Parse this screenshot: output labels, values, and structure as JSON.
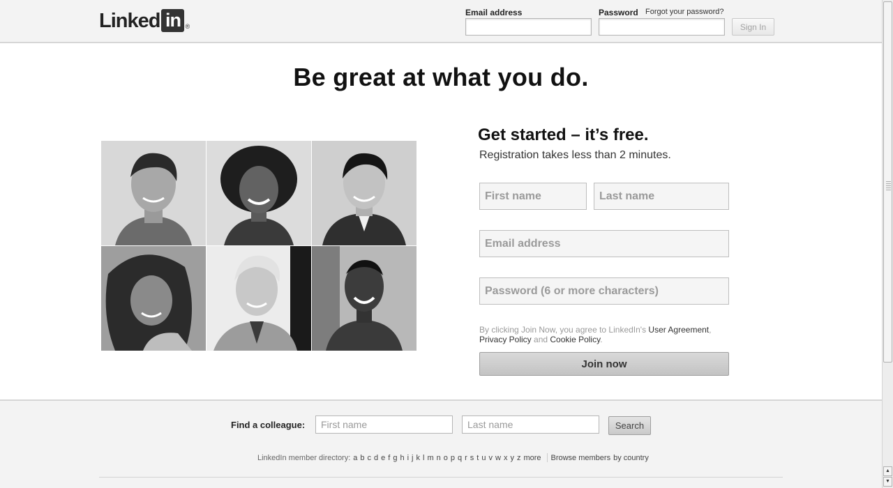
{
  "header": {
    "logo_text": "Linked",
    "logo_box_text": "in",
    "logo_registered": "®",
    "email_label": "Email address",
    "password_label": "Password",
    "forgot_link": "Forgot your password?",
    "signin_label": "Sign In"
  },
  "main": {
    "headline": "Be great at what you do.",
    "photos": [
      "person-1",
      "person-2",
      "person-3",
      "person-4",
      "person-5",
      "person-6"
    ]
  },
  "registration": {
    "title": "Get started – it’s free.",
    "subtitle": "Registration takes less than 2 minutes.",
    "first_name_placeholder": "First name",
    "last_name_placeholder": "Last name",
    "email_placeholder": "Email address",
    "password_placeholder": "Password (6 or more characters)",
    "terms_prefix": "By clicking Join Now, you agree to LinkedIn's ",
    "user_agreement": "User Agreement",
    "terms_comma": ",",
    "privacy_policy": "Privacy Policy",
    "terms_and": " and ",
    "cookie_policy": "Cookie Policy",
    "terms_period": ".",
    "join_label": "Join now"
  },
  "footer": {
    "find_label": "Find a colleague:",
    "first_name_placeholder": "First name",
    "last_name_placeholder": "Last name",
    "search_label": "Search",
    "directory_label": "LinkedIn member directory:",
    "letters": [
      "a",
      "b",
      "c",
      "d",
      "e",
      "f",
      "g",
      "h",
      "i",
      "j",
      "k",
      "l",
      "m",
      "n",
      "o",
      "p",
      "q",
      "r",
      "s",
      "t",
      "u",
      "v",
      "w",
      "x",
      "y",
      "z",
      "more"
    ],
    "browse_label": "Browse members",
    "by_country": "by country"
  },
  "colors": {
    "header_bg": "#f3f3f3",
    "logo_dark": "#333333",
    "join_button": "#cccccc"
  }
}
